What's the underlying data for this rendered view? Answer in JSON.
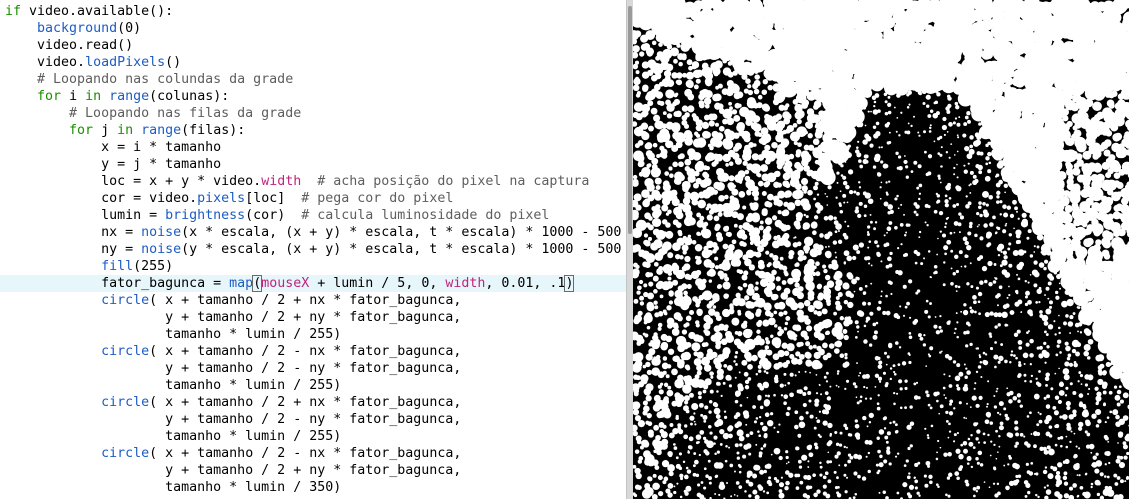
{
  "editor": {
    "lines": [
      [
        {
          "t": "if",
          "c": "kw"
        },
        {
          "t": " video.available():"
        }
      ],
      [
        {
          "t": "    "
        },
        {
          "t": "background",
          "c": "fn"
        },
        {
          "t": "(0)"
        }
      ],
      [
        {
          "t": "    video.read()"
        }
      ],
      [
        {
          "t": "    video."
        },
        {
          "t": "loadPixels",
          "c": "fn"
        },
        {
          "t": "()"
        }
      ],
      [
        {
          "t": "    # Loopando nas colundas da grade",
          "c": "cmt"
        }
      ],
      [
        {
          "t": "    "
        },
        {
          "t": "for",
          "c": "kw"
        },
        {
          "t": " i "
        },
        {
          "t": "in",
          "c": "kw"
        },
        {
          "t": " "
        },
        {
          "t": "range",
          "c": "fn"
        },
        {
          "t": "(colunas):"
        }
      ],
      [
        {
          "t": "        # Loopando nas filas da grade",
          "c": "cmt"
        }
      ],
      [
        {
          "t": "        "
        },
        {
          "t": "for",
          "c": "kw"
        },
        {
          "t": " j "
        },
        {
          "t": "in",
          "c": "kw"
        },
        {
          "t": " "
        },
        {
          "t": "range",
          "c": "fn"
        },
        {
          "t": "(filas):"
        }
      ],
      [
        {
          "t": "            x = i * tamanho"
        }
      ],
      [
        {
          "t": "            y = j * tamanho"
        }
      ],
      [
        {
          "t": "            loc = x + y * video."
        },
        {
          "t": "width",
          "c": "pr"
        },
        {
          "t": "  "
        },
        {
          "t": "# acha posição do pixel na captura",
          "c": "cmt"
        }
      ],
      [
        {
          "t": "            cor = video."
        },
        {
          "t": "pixels",
          "c": "fn"
        },
        {
          "t": "[loc]  "
        },
        {
          "t": "# pega cor do pixel",
          "c": "cmt"
        }
      ],
      [
        {
          "t": "            lumin = "
        },
        {
          "t": "brightness",
          "c": "fn"
        },
        {
          "t": "(cor)  "
        },
        {
          "t": "# calcula luminosidade do pixel",
          "c": "cmt"
        }
      ],
      [
        {
          "t": "            nx = "
        },
        {
          "t": "noise",
          "c": "fn"
        },
        {
          "t": "(x * escala, (x + y) * escala, t * escala) * 1000 - 500"
        }
      ],
      [
        {
          "t": "            ny = "
        },
        {
          "t": "noise",
          "c": "fn"
        },
        {
          "t": "(y * escala, (x + y) * escala, t * escala) * 1000 - 500"
        }
      ],
      [
        {
          "t": "            "
        },
        {
          "t": "fill",
          "c": "fn"
        },
        {
          "t": "(255)"
        }
      ],
      [
        {
          "t": "            fator_bagunca = "
        },
        {
          "t": "map",
          "c": "fn"
        },
        {
          "t": "(",
          "c": "mk"
        },
        {
          "t": "mouseX",
          "c": "pr"
        },
        {
          "t": " + lumin / 5, 0, "
        },
        {
          "t": "width",
          "c": "pr"
        },
        {
          "t": ", 0.01, .1"
        },
        {
          "t": ")",
          "c": "mk"
        }
      ],
      [
        {
          "t": "            "
        },
        {
          "t": "circle",
          "c": "fn"
        },
        {
          "t": "( x + tamanho / 2 + nx * fator_bagunca,"
        }
      ],
      [
        {
          "t": "                    y + tamanho / 2 + ny * fator_bagunca,"
        }
      ],
      [
        {
          "t": "                    tamanho * lumin / 255)"
        }
      ],
      [
        {
          "t": "            "
        },
        {
          "t": "circle",
          "c": "fn"
        },
        {
          "t": "( x + tamanho / 2 - nx * fator_bagunca,"
        }
      ],
      [
        {
          "t": "                    y + tamanho / 2 - ny * fator_bagunca,"
        }
      ],
      [
        {
          "t": "                    tamanho * lumin / 255)"
        }
      ],
      [
        {
          "t": "            "
        },
        {
          "t": "circle",
          "c": "fn"
        },
        {
          "t": "( x + tamanho / 2 + nx * fator_bagunca,"
        }
      ],
      [
        {
          "t": "                    y + tamanho / 2 - ny * fator_bagunca,"
        }
      ],
      [
        {
          "t": "                    tamanho * lumin / 255)"
        }
      ],
      [
        {
          "t": "            "
        },
        {
          "t": "circle",
          "c": "fn"
        },
        {
          "t": "( x + tamanho / 2 - nx * fator_bagunca,"
        }
      ],
      [
        {
          "t": "                    y + tamanho / 2 + ny * fator_bagunca,"
        }
      ],
      [
        {
          "t": "                    tamanho * lumin / 350)"
        }
      ]
    ],
    "current_line_index": 16
  },
  "colors": {
    "keyword": "#1a8f00",
    "function": "#1e5cc4",
    "comment": "#5e5e5e",
    "property": "#c0247b",
    "current_line_bg": "#e6f6fb",
    "preview_bg": "#000000",
    "preview_dots": "#ffffff"
  }
}
